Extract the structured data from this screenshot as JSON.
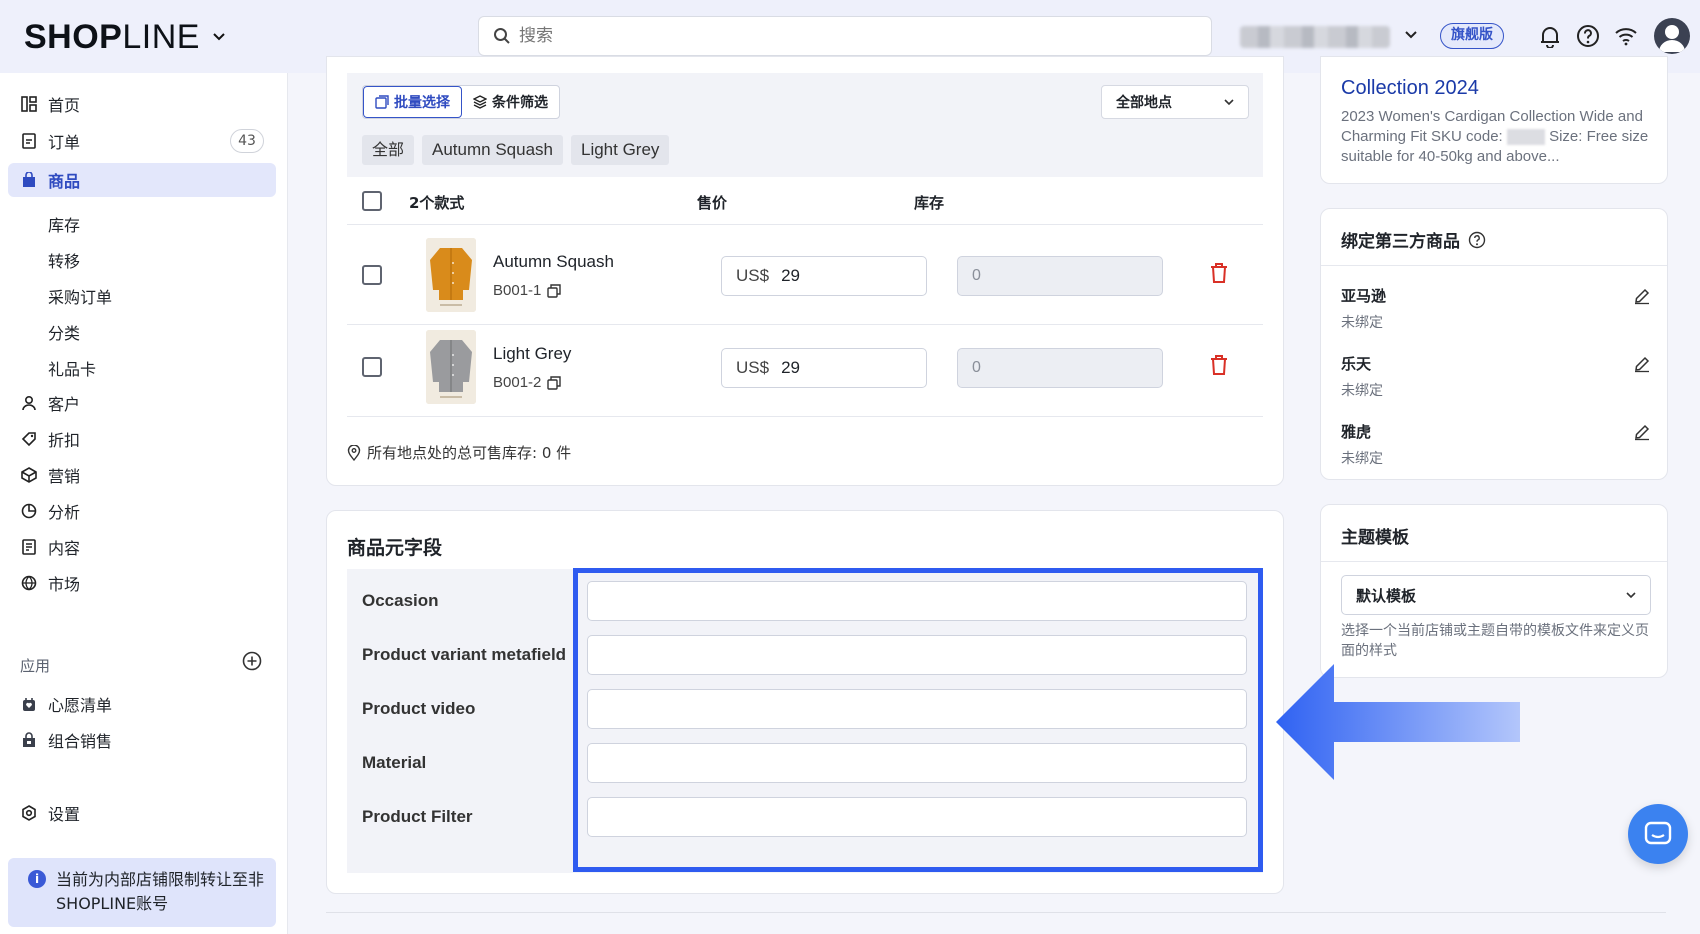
{
  "header": {
    "logo_bold": "SHOP",
    "logo_thin": "LINE",
    "search_placeholder": "搜索",
    "plan_badge": "旗舰版"
  },
  "sidebar": {
    "items": [
      {
        "label": "首页",
        "icon": "home-icon"
      },
      {
        "label": "订单",
        "icon": "orders-icon",
        "count": "43"
      },
      {
        "label": "商品",
        "icon": "products-icon",
        "active": true
      },
      {
        "label": "客户",
        "icon": "customer-icon"
      },
      {
        "label": "折扣",
        "icon": "discount-icon"
      },
      {
        "label": "营销",
        "icon": "marketing-icon"
      },
      {
        "label": "分析",
        "icon": "analytics-icon"
      },
      {
        "label": "内容",
        "icon": "content-icon"
      },
      {
        "label": "市场",
        "icon": "market-icon"
      }
    ],
    "sub_items": [
      "库存",
      "转移",
      "采购订单",
      "分类",
      "礼品卡"
    ],
    "apps_label": "应用",
    "apps": [
      {
        "label": "心愿清单",
        "icon": "wishlist-icon"
      },
      {
        "label": "组合销售",
        "icon": "bundle-icon"
      }
    ],
    "settings_label": "设置",
    "notice": "当前为内部店铺限制转让至非SHOPLINE账号"
  },
  "variants": {
    "bulk_select": "批量选择",
    "filter": "条件筛选",
    "location": "全部地点",
    "chips": [
      "全部",
      "Autumn Squash",
      "Light Grey"
    ],
    "col_count": "2个款式",
    "col_price": "售价",
    "col_stock": "库存",
    "rows": [
      {
        "name": "Autumn Squash",
        "sku": "B001-1",
        "currency": "US$",
        "price": "29",
        "stock": "0",
        "swatch": "#d98b1b"
      },
      {
        "name": "Light Grey",
        "sku": "B001-2",
        "currency": "US$",
        "price": "29",
        "stock": "0",
        "swatch": "#9a9b9e"
      }
    ],
    "total_stock": "所有地点处的总可售库存:  0 件"
  },
  "metafields": {
    "title": "商品元字段",
    "fields": [
      "Occasion",
      "Product variant metafield",
      "Product video",
      "Material",
      "Product Filter"
    ]
  },
  "seo": {
    "title": "Collection 2024",
    "desc_before": "2023 Women's Cardigan Collection Wide and Charming Fit SKU code:",
    "desc_after": "Size: Free size suitable for 40-50kg and above..."
  },
  "third_party": {
    "title": "绑定第三方商品",
    "items": [
      {
        "name": "亚马逊",
        "status": "未绑定"
      },
      {
        "name": "乐天",
        "status": "未绑定"
      },
      {
        "name": "雅虎",
        "status": "未绑定"
      }
    ]
  },
  "theme": {
    "title": "主题模板",
    "selected": "默认模板",
    "help": "选择一个当前店铺或主题自带的模板文件来定义页面的样式"
  },
  "colors": {
    "accent": "#3554c8",
    "highlight": "#2f5bf0",
    "danger": "#d93026"
  }
}
